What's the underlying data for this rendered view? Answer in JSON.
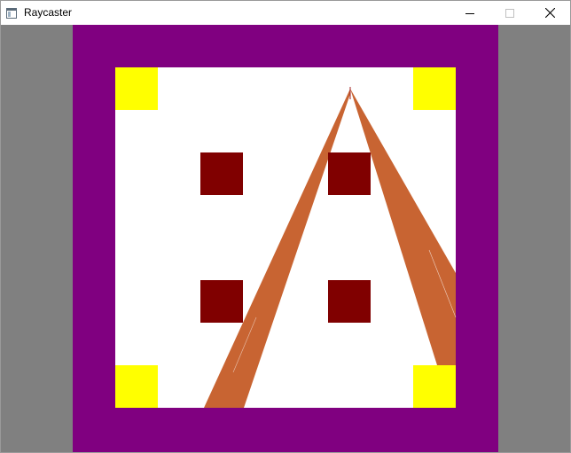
{
  "window": {
    "title": "Raycaster",
    "icon": "app-window-icon",
    "controls": [
      "minimize-icon",
      "maximize-icon",
      "close-icon"
    ]
  },
  "scene": {
    "colors": {
      "background": "#808080",
      "outer_wall": "#800080",
      "floor": "#ffffff",
      "corner_blocks": "#ffff00",
      "pillars": "#800000",
      "rays": "#c86432"
    }
  }
}
